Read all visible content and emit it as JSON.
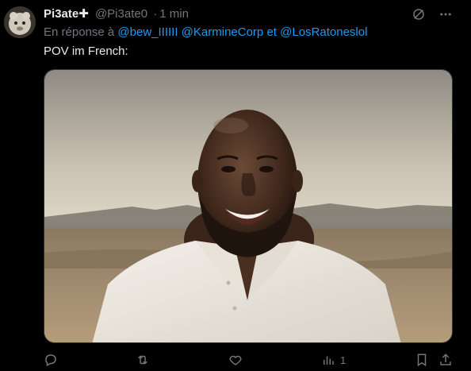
{
  "tweet": {
    "display_name": "Pi3ate",
    "badge": "✚",
    "handle": "@Pi3ate0",
    "separator": "·",
    "time": "1 min",
    "reply_prefix": "En réponse à",
    "mentions": [
      "@bew_IIIIII",
      "@KarmineCorp",
      "et",
      "@LosRatoneslol"
    ],
    "text": "POV im French:",
    "views_count": "1"
  },
  "icons": {
    "grok": "grok-slash-icon",
    "more": "more-dots-icon",
    "reply": "reply-bubble-icon",
    "retweet": "retweet-icon",
    "like": "heart-icon",
    "views": "bar-chart-icon",
    "bookmark": "bookmark-icon",
    "share": "share-icon"
  },
  "colors": {
    "background": "#000000",
    "text_primary": "#e7e9ea",
    "text_secondary": "#71767b",
    "accent_link": "#1d9bf0"
  }
}
